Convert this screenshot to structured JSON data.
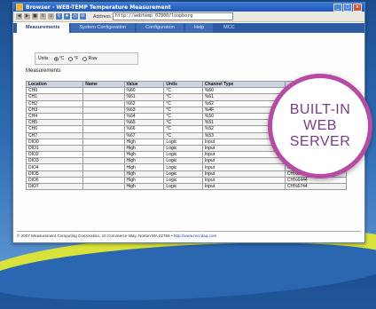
{
  "window": {
    "title": "Browser - WEB-TEMP Temperature Measurement",
    "address_label": "Address",
    "address": "http://webtemp_07800/loopborg"
  },
  "tabs": [
    {
      "label": "Measurements",
      "active": true
    },
    {
      "label": "System Configuration",
      "active": false
    },
    {
      "label": "Configuration",
      "active": false
    },
    {
      "label": "Help",
      "active": false
    },
    {
      "label": "MCC",
      "active": false
    }
  ],
  "units": {
    "label": "Units:",
    "options": [
      {
        "label": "°C",
        "selected": true
      },
      {
        "label": "°F",
        "selected": false
      },
      {
        "label": "Raw",
        "selected": false
      }
    ]
  },
  "section_title": "Measurements",
  "table": {
    "headers": [
      "Location",
      "Name",
      "Value",
      "Units",
      "Channel Type",
      ""
    ],
    "rows": [
      [
        "CH0",
        "",
        "%60",
        "°C",
        "%60",
        ""
      ],
      [
        "CH1",
        "",
        "%61",
        "°C",
        "%61",
        ""
      ],
      [
        "CH2",
        "",
        "%62",
        "°C",
        "%62",
        ""
      ],
      [
        "CH3",
        "",
        "%63",
        "°C",
        "%4F",
        ""
      ],
      [
        "CH4",
        "",
        "%64",
        "°C",
        "%50",
        ""
      ],
      [
        "CH5",
        "",
        "%65",
        "°C",
        "%51",
        ""
      ],
      [
        "CH6",
        "",
        "%66",
        "°C",
        "%52",
        ""
      ],
      [
        "CH7",
        "",
        "%67",
        "°C",
        "%53",
        ""
      ],
      [
        "DIO0",
        "",
        "High",
        "Logic",
        "Input",
        ""
      ],
      [
        "DIO1",
        "",
        "High",
        "Logic",
        "Input",
        ""
      ],
      [
        "DIO2",
        "",
        "High",
        "Logic",
        "Input",
        "CH%6044"
      ],
      [
        "DIO3",
        "",
        "High",
        "Logic",
        "Input",
        "CH%6144"
      ],
      [
        "DIO4",
        "",
        "High",
        "Logic",
        "Input",
        "CH%6244"
      ],
      [
        "DIO5",
        "",
        "High",
        "Logic",
        "Input",
        "CH%6344"
      ],
      [
        "DIO6",
        "",
        "High",
        "Logic",
        "Input",
        "CH%6444"
      ],
      [
        "DIO7",
        "",
        "High",
        "Logic",
        "Input",
        "CH%6744"
      ]
    ]
  },
  "footer": {
    "text": "© 2007 Measurement Computing Corporation, 10 Commerce Way, Norton MA 02766 •",
    "link": "http://www.mccdaq.com"
  },
  "badge": {
    "lines": [
      "BUILT-IN",
      "WEB",
      "SERVER"
    ]
  },
  "colors": {
    "badge_border": "#b84aa3",
    "badge_text": "#7b3a8c",
    "tab_bar": "#2c5aa3",
    "swoosh": "#d8e23a"
  }
}
